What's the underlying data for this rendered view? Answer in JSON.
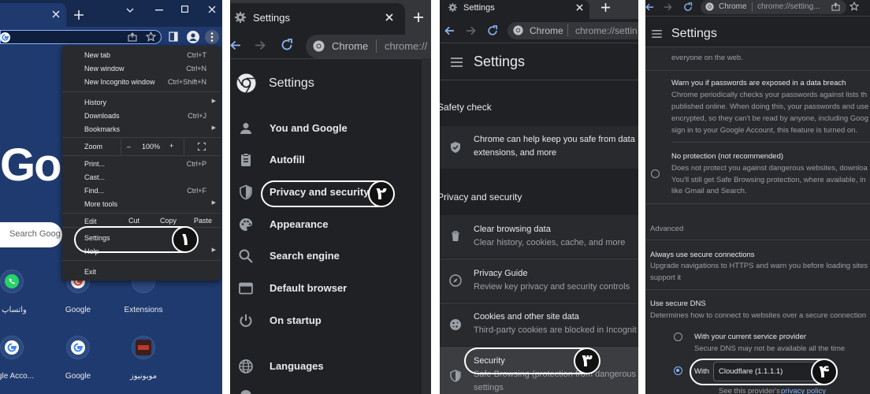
{
  "panel1": {
    "menu": {
      "items": [
        {
          "label": "New tab",
          "shortcut": "Ctrl+T"
        },
        {
          "label": "New window",
          "shortcut": "Ctrl+N"
        },
        {
          "label": "New Incognito window",
          "shortcut": "Ctrl+Shift+N"
        },
        {
          "label": "History",
          "shortcut": ""
        },
        {
          "label": "Downloads",
          "shortcut": "Ctrl+J"
        },
        {
          "label": "Bookmarks",
          "shortcut": ""
        },
        {
          "label": "Zoom",
          "shortcut": ""
        },
        {
          "label": "Print...",
          "shortcut": "Ctrl+P"
        },
        {
          "label": "Cast...",
          "shortcut": ""
        },
        {
          "label": "Find...",
          "shortcut": "Ctrl+F"
        },
        {
          "label": "More tools",
          "shortcut": ""
        },
        {
          "label": "Edit",
          "shortcut": ""
        },
        {
          "label": "Settings",
          "shortcut": ""
        },
        {
          "label": "Help",
          "shortcut": ""
        },
        {
          "label": "Exit",
          "shortcut": ""
        }
      ],
      "zoom": {
        "minus": "–",
        "value": "100%",
        "plus": "+"
      },
      "edit": {
        "cut": "Cut",
        "copy": "Copy",
        "paste": "Paste"
      }
    },
    "google_logo": "Go",
    "search_placeholder": "Search Goog",
    "shortcuts": [
      "واتساپ",
      "Google",
      "Extensions",
      "gle Acco...",
      "Google",
      "موبونیوز"
    ],
    "step": "١"
  },
  "panel2": {
    "tab_title": "Settings",
    "address": {
      "site": "Chrome",
      "url": "chrome://"
    },
    "heading": "Settings",
    "nav": [
      "You and Google",
      "Autofill",
      "Privacy and security",
      "Appearance",
      "Search engine",
      "Default browser",
      "On startup",
      "Languages"
    ],
    "step": "٢"
  },
  "panel3": {
    "tab_title": "Settings",
    "address": {
      "site": "Chrome",
      "url": "chrome://settin"
    },
    "heading": "Settings",
    "safety_heading": "Safety check",
    "safety_text": [
      "Chrome can help keep you safe from data",
      "extensions, and more"
    ],
    "privacy_heading": "Privacy and security",
    "cards": [
      {
        "title": "Clear browsing data",
        "sub": "Clear history, cookies, cache, and more"
      },
      {
        "title": "Privacy Guide",
        "sub": "Review key privacy and security controls"
      },
      {
        "title": "Cookies and other site data",
        "sub": "Third-party cookies are blocked in Incognit"
      },
      {
        "title": "Security",
        "sub": "Safe Browsing (protection from dangerous",
        "sub2": "settings"
      }
    ],
    "step": "٣"
  },
  "panel4": {
    "address": {
      "site": "Chrome",
      "url": "chrome://setting..."
    },
    "heading": "Settings",
    "top_text": "everyone on the web.",
    "warn_title": "Warn you if passwords are exposed in a data breach",
    "warn_lines": [
      "Chrome periodically checks your passwords against lists th",
      "published online. When doing this, your passwords and use",
      "encrypted, so they can't be read by anyone, including Goog",
      "sign in to your Google Account, this feature is turned on."
    ],
    "noprot_title": "No protection (not recommended)",
    "noprot_lines": [
      "Does not protect you against dangerous websites, downloa",
      "You'll still get Safe Browsing protection, where available, in",
      "like Gmail and Search."
    ],
    "advanced": "Advanced",
    "secure_title": "Always use secure connections",
    "secure_lines": [
      "Upgrade navigations to HTTPS and warn you before loading sites",
      "support it"
    ],
    "dns_title": "Use secure DNS",
    "dns_sub": "Determines how to connect to websites over a secure connection",
    "current_title": "With your current service provider",
    "current_sub": "Secure DNS may not be available all the time",
    "with_label": "With",
    "dns_provider": "Cloudflare (1.1.1.1)",
    "policy_text": "See this provider's",
    "policy_link": "privacy policy",
    "step": "۴"
  }
}
